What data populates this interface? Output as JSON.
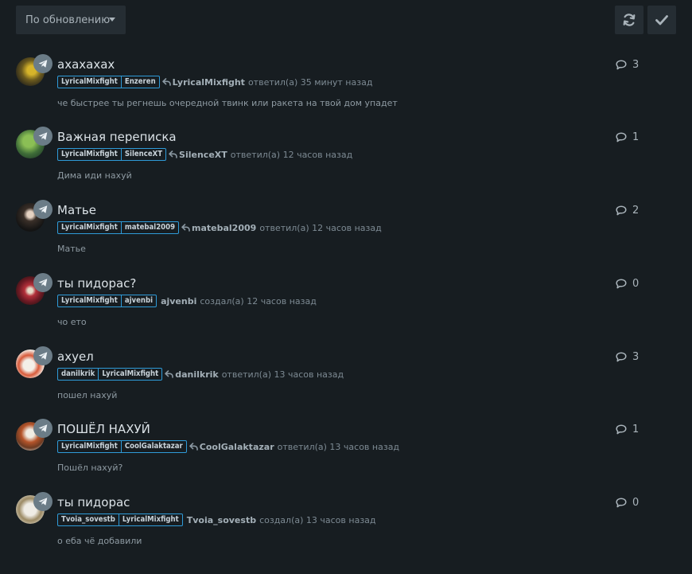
{
  "toolbar": {
    "sort_label": "По обновлению",
    "sort_icon": "chevron-down-icon",
    "refresh_icon": "refresh-icon",
    "mark_read_icon": "check-icon"
  },
  "colors": {
    "background": "#171d21",
    "button": "#252d33",
    "tag_border": "#2f9bd8",
    "badge": "#6b7c87"
  },
  "topics": [
    {
      "title": "ахахахах",
      "tags": [
        "LyricalMixfight",
        "Enzeren"
      ],
      "reply_icon": true,
      "author": "LyricalMixfight",
      "action": "ответил(а) 35 минут назад",
      "excerpt": "че быстрее ты регнешь очередной твинк или ракета на твой дом упадет",
      "replies": "3"
    },
    {
      "title": "Важная переписка",
      "tags": [
        "LyricalMixfight",
        "SilenceXT"
      ],
      "reply_icon": true,
      "author": "SilenceXT",
      "action": "ответил(а) 12 часов назад",
      "excerpt": "Дима иди нахуй",
      "replies": "1"
    },
    {
      "title": "Матье",
      "tags": [
        "LyricalMixfight",
        "matebal2009"
      ],
      "reply_icon": true,
      "author": "matebal2009",
      "action": "ответил(а) 12 часов назад",
      "excerpt": "Матье",
      "replies": "2"
    },
    {
      "title": "ты пидорас?",
      "tags": [
        "LyricalMixfight",
        "ajvenbi"
      ],
      "reply_icon": false,
      "author": "ajvenbi",
      "action": "создал(а) 12 часов назад",
      "excerpt": "чо ето",
      "replies": "0"
    },
    {
      "title": "ахуел",
      "tags": [
        "danilkrik",
        "LyricalMixfight"
      ],
      "reply_icon": true,
      "author": "danilkrik",
      "action": "ответил(а) 13 часов назад",
      "excerpt": "пошел нахуй",
      "replies": "3"
    },
    {
      "title": "ПОШЁЛ НАХУЙ",
      "tags": [
        "LyricalMixfight",
        "CoolGalaktazar"
      ],
      "reply_icon": true,
      "author": "CoolGalaktazar",
      "action": "ответил(а) 13 часов назад",
      "excerpt": "Пошёл нахуй?",
      "replies": "1"
    },
    {
      "title": "ты пидорас",
      "tags": [
        "Tvoia_sovestb",
        "LyricalMixfight"
      ],
      "reply_icon": false,
      "author": "Tvoia_sovestb",
      "action": "создал(а) 13 часов назад",
      "excerpt": "о еба чё добавили",
      "replies": "0"
    }
  ]
}
